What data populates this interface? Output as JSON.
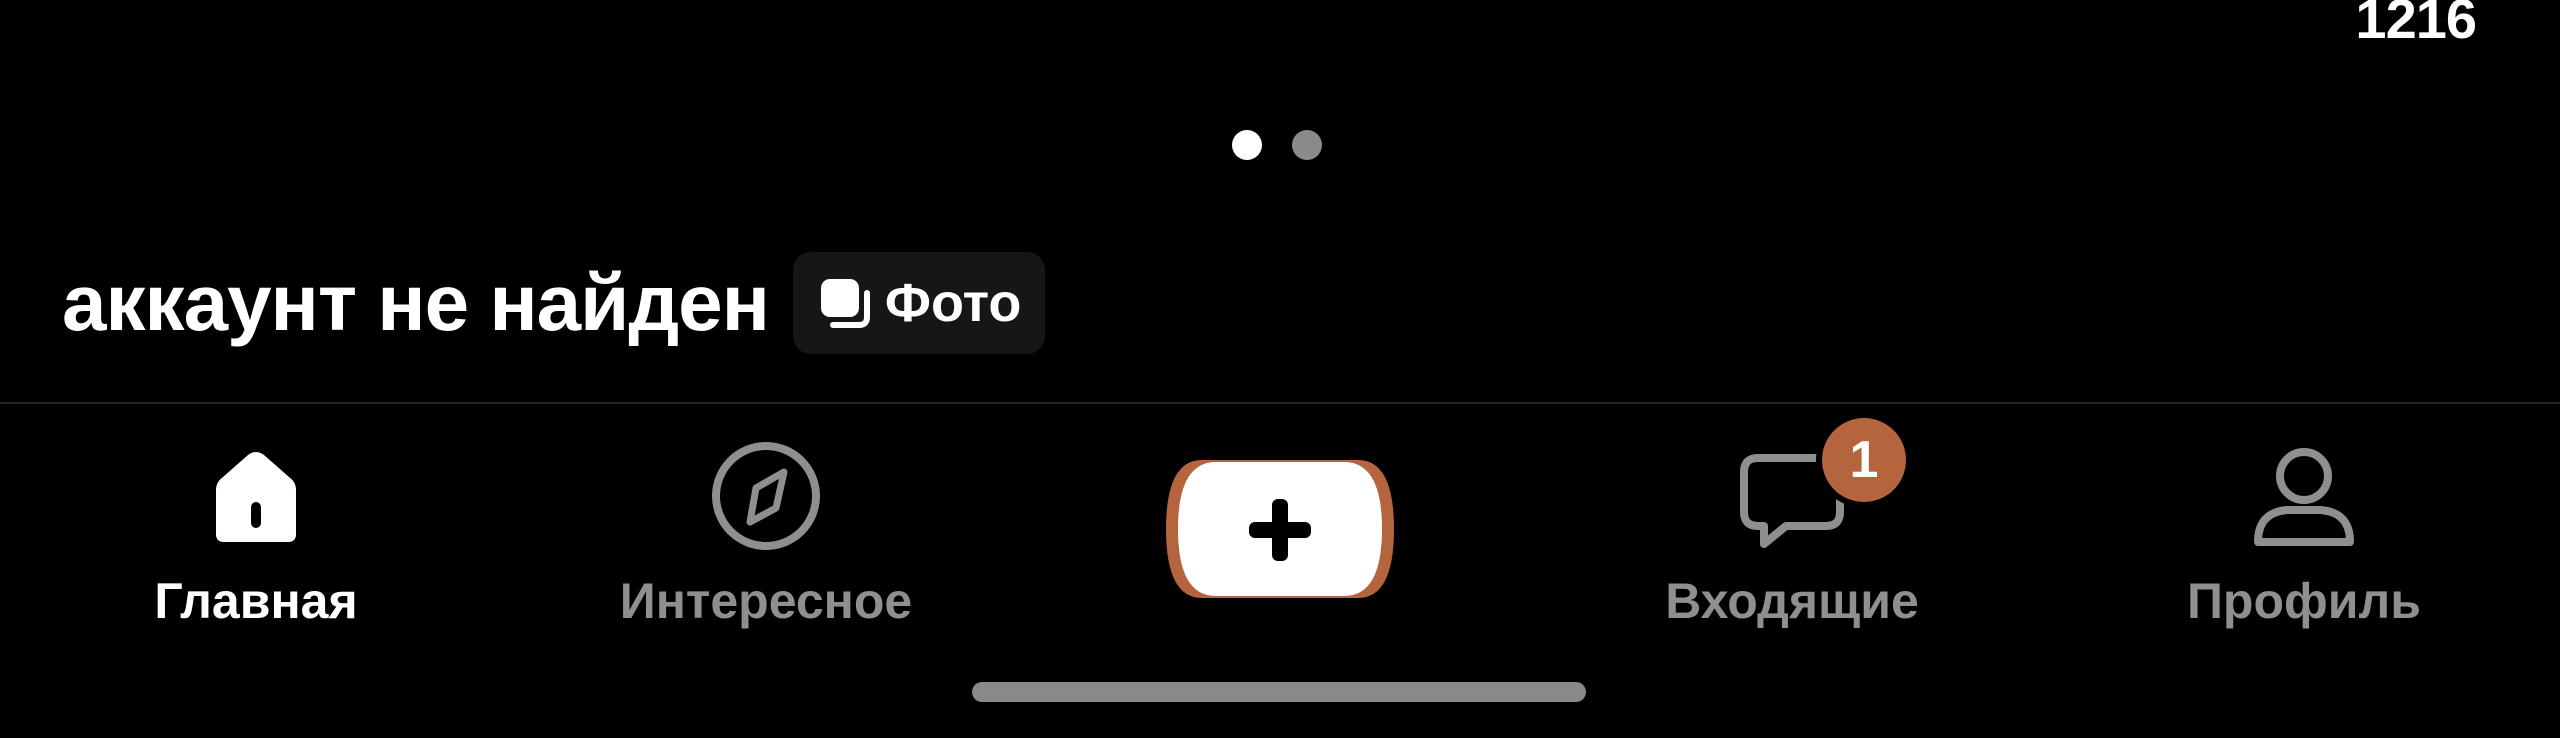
{
  "header": {
    "count": "1216"
  },
  "pager": {
    "total": 2,
    "active_index": 0
  },
  "caption": {
    "title": "аккаунт не найден",
    "media_badge": {
      "label": "Фото",
      "icon": "photos-stack-icon"
    }
  },
  "bottom_nav": {
    "items": [
      {
        "label": "Главная",
        "icon": "home-icon",
        "active": true
      },
      {
        "label": "Интересное",
        "icon": "compass-icon",
        "active": false
      },
      {
        "label": "",
        "icon": "plus-icon",
        "active": false
      },
      {
        "label": "Входящие",
        "icon": "chat-bubble-icon",
        "active": false,
        "badge": "1"
      },
      {
        "label": "Профиль",
        "icon": "person-icon",
        "active": false
      }
    ]
  },
  "colors": {
    "background": "#000000",
    "active_text": "#ffffff",
    "inactive_text": "#8f8f8f",
    "accent": "#b5653e",
    "badge_bg": "#161616"
  }
}
